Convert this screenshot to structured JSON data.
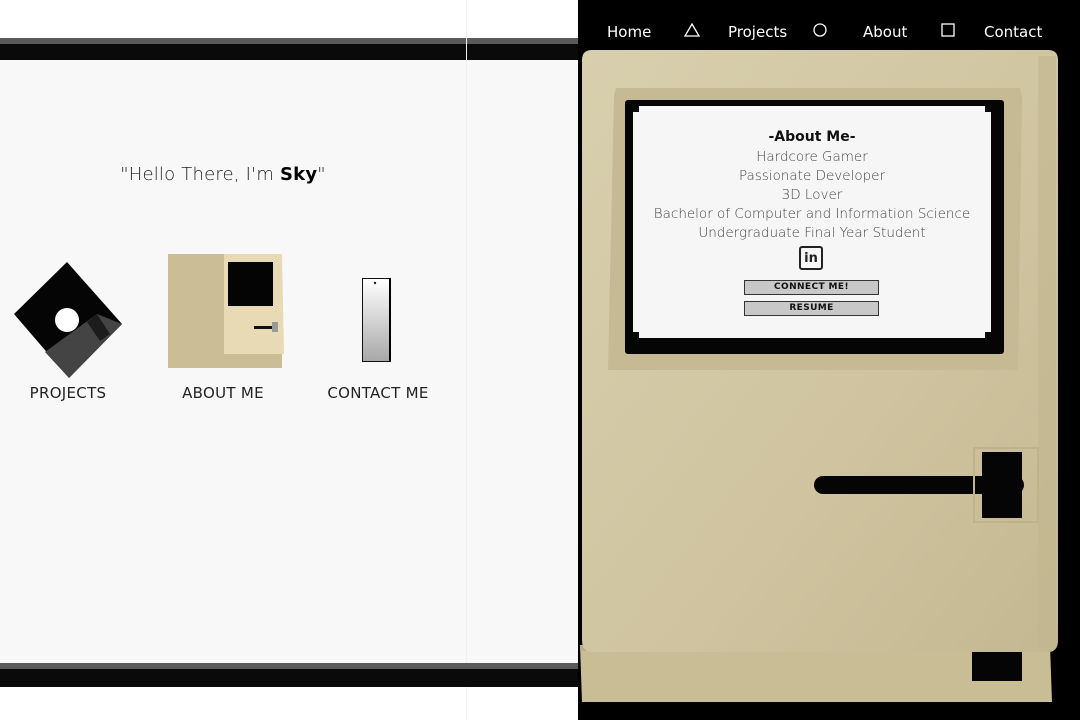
{
  "left_scene": {
    "greeting_prefix": "\"Hello There, I'm ",
    "greeting_name": "Sky",
    "greeting_suffix": "\"",
    "icons": [
      {
        "label": "PROJECTS",
        "icon": "floppy-disk-icon"
      },
      {
        "label": "ABOUT ME",
        "icon": "vintage-computer-icon"
      },
      {
        "label": "CONTACT ME",
        "icon": "phone-icon"
      }
    ]
  },
  "nav": {
    "items": [
      {
        "label": "Home"
      },
      {
        "label": "Projects"
      },
      {
        "label": "About"
      },
      {
        "label": "Contact"
      }
    ],
    "symbols": [
      "triangle-icon",
      "circle-icon",
      "square-icon"
    ]
  },
  "about_screen": {
    "heading": "-About Me-",
    "lines": [
      "Hardcore Gamer",
      "Passionate Developer",
      "3D Lover",
      "Bachelor of Computer and Information Science",
      "Undergraduate Final Year Student"
    ],
    "linkedin_text": "in",
    "connect_button": "CONNECT ME!",
    "resume_button": "RESUME"
  },
  "colors": {
    "mac_beige": "#d2c7a4",
    "screen_bg": "#f6f6f6",
    "nav_bg": "#000000",
    "page_bg": "#f8f8f8"
  }
}
